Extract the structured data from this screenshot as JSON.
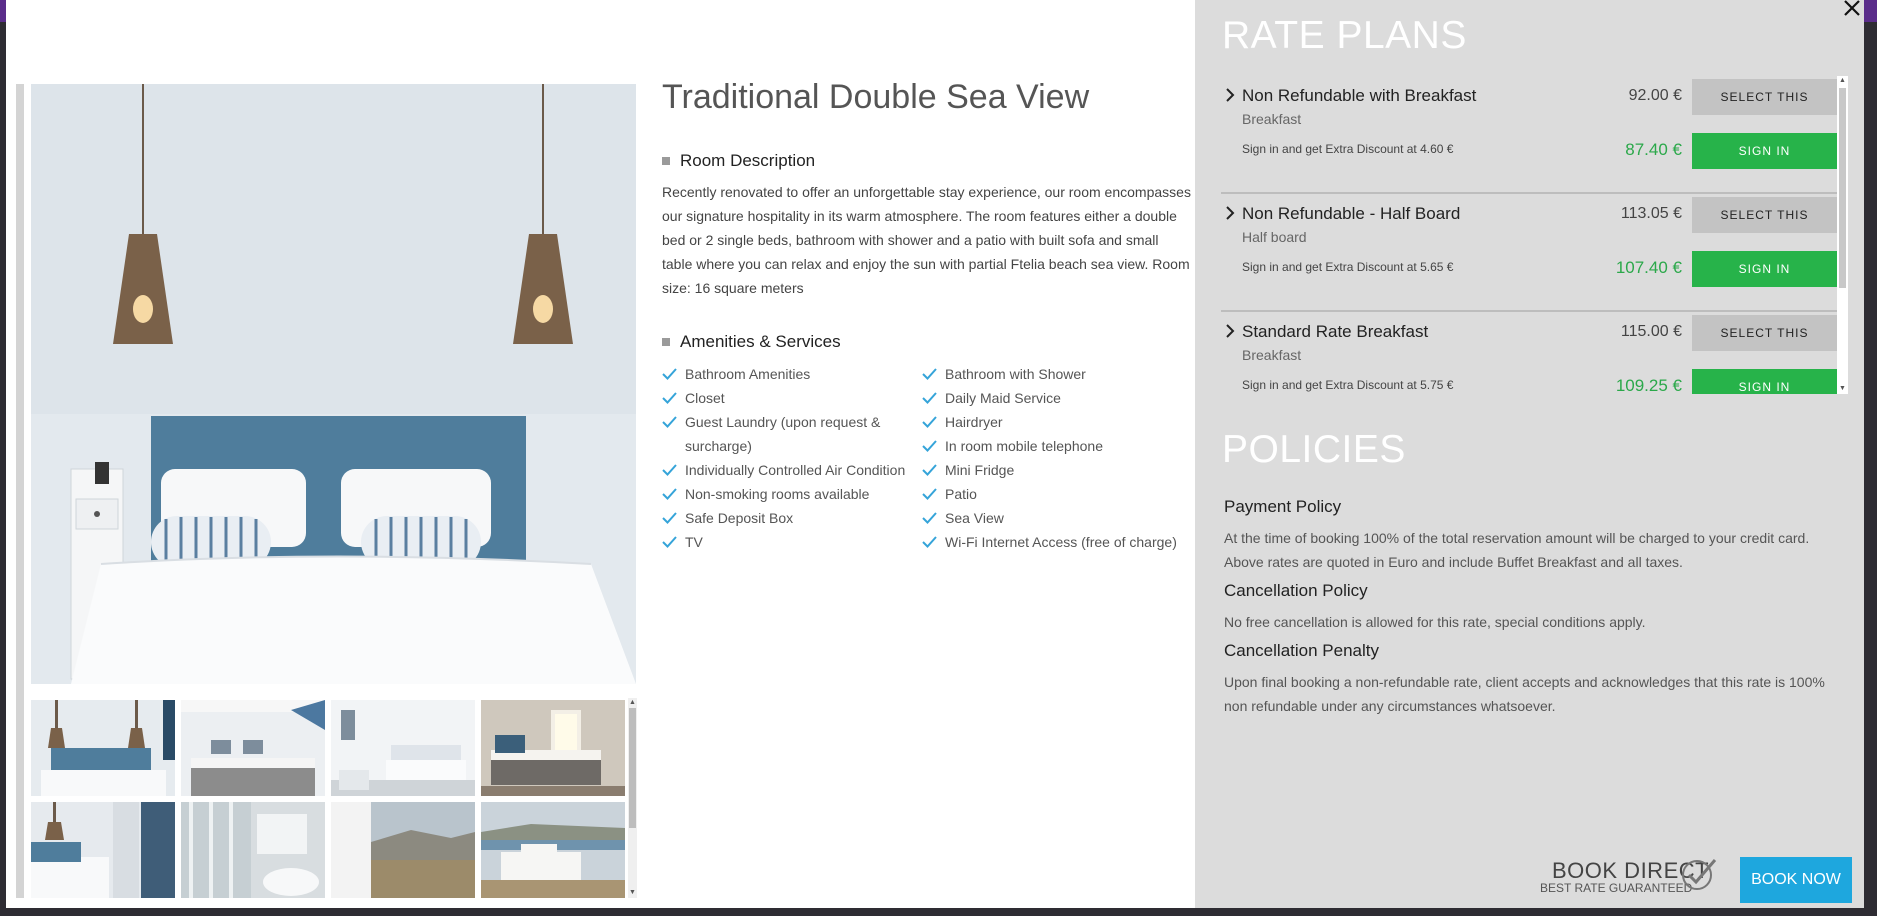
{
  "room": {
    "title": "Traditional Double Sea View",
    "description_heading": "Room Description",
    "description": "Recently renovated to offer an unforgettable stay experience, our room encompasses our signature hospitality in its warm atmosphere. The room features either a double bed or 2 single beds, bathroom with shower and a patio with built sofa and small table where you can relax and enjoy the sun with partial Ftelia beach sea view. Room size: 16 square meters",
    "amenities_heading": "Amenities & Services",
    "amenities_left": [
      "Bathroom Amenities",
      "Closet",
      "Guest Laundry (upon request & surcharge)",
      "Individually Controlled Air Condition",
      "Non-smoking rooms available",
      "Safe Deposit Box",
      "TV"
    ],
    "amenities_right": [
      "Bathroom with Shower",
      "Daily Maid Service",
      "Hairdryer",
      "In room mobile telephone",
      "Mini Fridge",
      "Patio",
      "Sea View",
      "Wi-Fi Internet Access (free of charge)"
    ]
  },
  "rate_plans": {
    "title": "RATE PLANS",
    "select_label": "SELECT THIS",
    "signin_label": "SIGN IN",
    "items": [
      {
        "name": "Non Refundable with Breakfast",
        "board": "Breakfast",
        "price": "92.00 €",
        "signin_text": "Sign in and get Extra Discount at 4.60 €",
        "discount_price": "87.40 €"
      },
      {
        "name": "Non Refundable - Half Board",
        "board": "Half board",
        "price": "113.05 €",
        "signin_text": "Sign in and get Extra Discount at 5.65 €",
        "discount_price": "107.40 €"
      },
      {
        "name": "Standard Rate Breakfast",
        "board": "Breakfast",
        "price": "115.00 €",
        "signin_text": "Sign in and get Extra Discount at 5.75 €",
        "discount_price": "109.25 €"
      }
    ]
  },
  "policies": {
    "title": "POLICIES",
    "payment_heading": "Payment Policy",
    "payment_text": "At the time of booking 100% of the total reservation amount will be charged to your credit card. Above rates are quoted in Euro and include Buffet Breakfast and all taxes.",
    "cancellation_heading": "Cancellation Policy",
    "cancellation_text": "No free cancellation is allowed for this rate, special conditions apply.",
    "penalty_heading": "Cancellation Penalty",
    "penalty_text": "Upon final booking a non-refundable rate, client accepts and acknowledges that this rate is 100% non refundable under any circumstances whatsoever."
  },
  "footer": {
    "book_direct": "BOOK DIRECT",
    "best_rate": "BEST RATE GUARANTEED",
    "book_now": "BOOK NOW"
  },
  "colors": {
    "accent_green": "#27b34a",
    "price_green": "#2ba84a",
    "book_blue": "#1ea7de",
    "panel_gray": "#dcdcdc"
  },
  "icons": [
    "close-icon",
    "chevron-right-icon",
    "check-icon",
    "checkmark-badge-icon"
  ]
}
